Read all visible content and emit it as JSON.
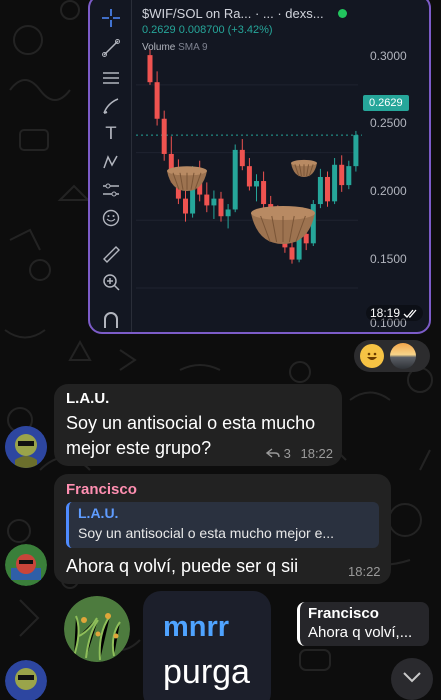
{
  "chart_bubble": {
    "pair_title": "$WIF/SOL on Ra... · ... · dexs...",
    "price_line": "0.2629  0.008700 (+3.42%)",
    "volume_label": "Volume",
    "volume_indicator": "SMA 9",
    "current_price": "0.2629",
    "axis_ticks": [
      "0.3000",
      "0.2500",
      "0.2000",
      "0.1500",
      "0.1000"
    ],
    "time": "18:19",
    "read_status": "double-check-icon",
    "tools": [
      "crosshair-icon",
      "trendline-icon",
      "fib-icon",
      "brush-icon",
      "text-icon",
      "pattern-icon",
      "prediction-icon",
      "emoji-icon",
      "ruler-icon",
      "zoom-icon",
      "magnet-icon"
    ],
    "colors": {
      "up": "#26a69a",
      "down": "#ef5350",
      "border": "#7c5cc8"
    }
  },
  "chart_data": {
    "type": "candlestick",
    "title": "$WIF/SOL on Ra... · ... · dexs...",
    "ylim": [
      0.09,
      0.33
    ],
    "ticks": [
      0.3,
      0.25,
      0.2,
      0.15,
      0.1
    ],
    "current": 0.2629,
    "change": 0.0087,
    "change_pct": "+3.42%",
    "candles": [
      [
        0.322,
        0.326,
        0.3,
        0.302
      ],
      [
        0.302,
        0.31,
        0.27,
        0.275
      ],
      [
        0.275,
        0.281,
        0.244,
        0.249
      ],
      [
        0.249,
        0.262,
        0.228,
        0.232
      ],
      [
        0.232,
        0.245,
        0.212,
        0.216
      ],
      [
        0.216,
        0.226,
        0.199,
        0.205
      ],
      [
        0.205,
        0.24,
        0.202,
        0.236
      ],
      [
        0.236,
        0.244,
        0.214,
        0.219
      ],
      [
        0.219,
        0.228,
        0.206,
        0.211
      ],
      [
        0.211,
        0.222,
        0.201,
        0.216
      ],
      [
        0.216,
        0.221,
        0.199,
        0.203
      ],
      [
        0.203,
        0.212,
        0.194,
        0.208
      ],
      [
        0.208,
        0.256,
        0.206,
        0.252
      ],
      [
        0.252,
        0.26,
        0.237,
        0.24
      ],
      [
        0.24,
        0.246,
        0.222,
        0.225
      ],
      [
        0.225,
        0.234,
        0.214,
        0.229
      ],
      [
        0.229,
        0.236,
        0.208,
        0.212
      ],
      [
        0.212,
        0.218,
        0.199,
        0.202
      ],
      [
        0.202,
        0.211,
        0.188,
        0.192
      ],
      [
        0.192,
        0.198,
        0.176,
        0.18
      ],
      [
        0.18,
        0.188,
        0.168,
        0.171
      ],
      [
        0.171,
        0.194,
        0.169,
        0.19
      ],
      [
        0.19,
        0.196,
        0.178,
        0.183
      ],
      [
        0.183,
        0.215,
        0.181,
        0.212
      ],
      [
        0.212,
        0.238,
        0.209,
        0.232
      ],
      [
        0.232,
        0.236,
        0.21,
        0.214
      ],
      [
        0.214,
        0.246,
        0.212,
        0.241
      ],
      [
        0.241,
        0.248,
        0.221,
        0.226
      ],
      [
        0.226,
        0.244,
        0.223,
        0.24
      ],
      [
        0.24,
        0.266,
        0.236,
        0.2629
      ]
    ]
  },
  "reactions": {
    "emoji": "grinning-face-icon",
    "reactor": "reactor-avatar"
  },
  "messages": [
    {
      "sender": "L.A.U.",
      "text_line1": "Soy un antisocial o esta mucho",
      "text_line2": "mejor este grupo?",
      "reply_count": "3",
      "time": "18:22",
      "sender_color": "#6ab7ff"
    },
    {
      "sender": "Francisco",
      "quote_sender": "L.A.U.",
      "quote_text": "Soy un antisocial o esta mucho mejor e...",
      "text": "Ahora q volví, puede ser q sii",
      "time": "18:22",
      "sender_color": "#ff8fb1"
    }
  ],
  "sticker": {
    "line1": "mnrr",
    "line2": "purga",
    "line1_color": "#4fa3ff"
  },
  "reply_preview": {
    "sender": "Francisco",
    "text": "Ahora q volví,..."
  },
  "scroll_button": "chevron-down-icon"
}
